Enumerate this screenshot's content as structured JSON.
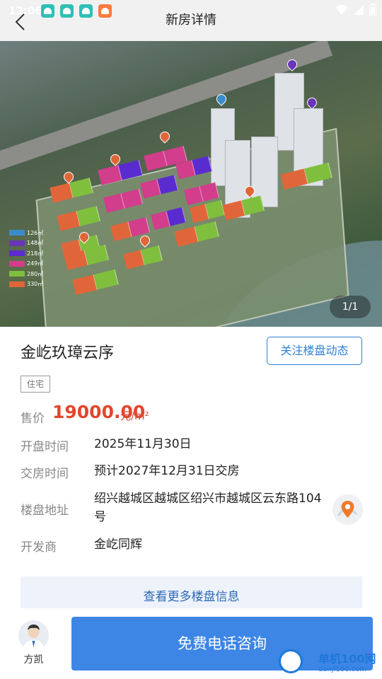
{
  "status_bar": {
    "time": "12:06"
  },
  "header": {
    "title": "新房详情"
  },
  "hero": {
    "counter": "1/1",
    "legend": [
      {
        "label": "126㎡",
        "color": "#3a8cc8"
      },
      {
        "label": "148㎡",
        "color": "#6a35b8"
      },
      {
        "label": "218㎡",
        "color": "#5a2cd0"
      },
      {
        "label": "249㎡",
        "color": "#d23d8c"
      },
      {
        "label": "280㎡",
        "color": "#7fbf3d"
      },
      {
        "label": "330㎡",
        "color": "#e0663a"
      }
    ]
  },
  "property": {
    "name": "金屹玖璋云序",
    "follow_label": "关注楼盘动态",
    "tag": "住宅",
    "price_label": "售价",
    "price_value": "19000.00",
    "price_unit": "元/m²",
    "details": [
      {
        "label": "开盘时间",
        "value": "2025年11月30日"
      },
      {
        "label": "交房时间",
        "value": "预计2027年12月31日交房"
      },
      {
        "label": "楼盘地址",
        "value": "绍兴越城区越城区绍兴市越城区云东路104号"
      },
      {
        "label": "开发商",
        "value": "金屹同辉"
      }
    ],
    "more_label": "查看更多楼盘信息"
  },
  "bottom_bar": {
    "agent_name": "方凯",
    "call_label": "免费电话咨询"
  },
  "watermark": {
    "text": "单机100网",
    "url": "danji100.com"
  },
  "colors": {
    "accent": "#3d86e6",
    "price": "#e2472d",
    "link": "#2c67b8"
  }
}
